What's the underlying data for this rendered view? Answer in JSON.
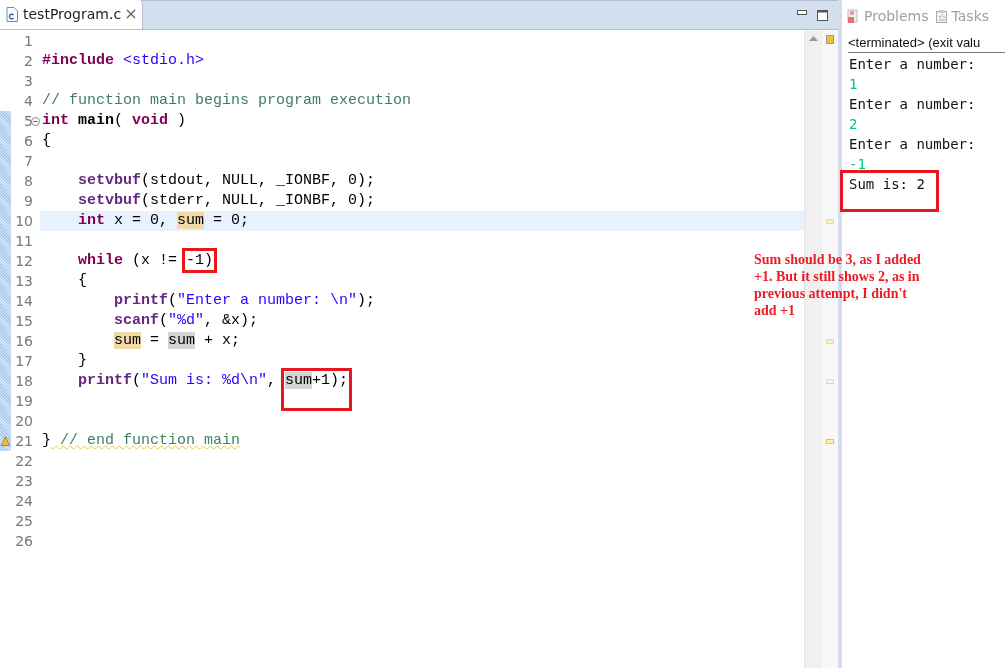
{
  "editor": {
    "tab": {
      "title": "testProgram.c",
      "selected": true
    },
    "lines": [
      {
        "number": "1",
        "changed": false
      },
      {
        "number": "2",
        "changed": false,
        "segments": [
          {
            "text": "#include",
            "kind": "keyword"
          },
          {
            "text": " <stdio.h>",
            "kind": "string"
          }
        ]
      },
      {
        "number": "3",
        "changed": false
      },
      {
        "number": "4",
        "changed": false,
        "segments": [
          {
            "text": "// function main begins program execution",
            "kind": "comment"
          }
        ]
      },
      {
        "number": "5",
        "changed": true,
        "folded": false,
        "segments": [
          {
            "text": "int",
            "kind": "keyword"
          },
          {
            "text": " main",
            "kind": "declaration"
          },
          {
            "text": "( ",
            "kind": "plain"
          },
          {
            "text": "void",
            "kind": "keyword"
          },
          {
            "text": " )",
            "kind": "plain"
          }
        ]
      },
      {
        "number": "6",
        "changed": true,
        "segments": [
          {
            "text": "{",
            "kind": "plain"
          }
        ]
      },
      {
        "number": "7",
        "changed": true
      },
      {
        "number": "8",
        "changed": true,
        "segments": [
          {
            "text": "    setvbuf",
            "kind": "function"
          },
          {
            "text": "(stdout, NULL, _IONBF, 0);",
            "kind": "plain"
          }
        ]
      },
      {
        "number": "9",
        "changed": true,
        "segments": [
          {
            "text": "    setvbuf",
            "kind": "function"
          },
          {
            "text": "(stderr, NULL, _IONBF, 0);",
            "kind": "plain"
          }
        ]
      },
      {
        "number": "10",
        "changed": true,
        "current": true,
        "segments": [
          {
            "text": "    int",
            "kind": "keyword"
          },
          {
            "text": " x = 0, ",
            "kind": "plain"
          },
          {
            "text": "sum",
            "kind": "plain",
            "occurrence_write": true
          },
          {
            "text": " = 0;",
            "kind": "plain"
          }
        ]
      },
      {
        "number": "11",
        "changed": true
      },
      {
        "number": "12",
        "changed": true,
        "segments": [
          {
            "text": "    while",
            "kind": "keyword"
          },
          {
            "text": " (x != ",
            "kind": "plain"
          },
          {
            "text": "-1)",
            "kind": "plain",
            "boxed": true
          }
        ]
      },
      {
        "number": "13",
        "changed": true,
        "segments": [
          {
            "text": "    {",
            "kind": "plain"
          }
        ]
      },
      {
        "number": "14",
        "changed": true,
        "segments": [
          {
            "text": "        printf",
            "kind": "function"
          },
          {
            "text": "(",
            "kind": "plain"
          },
          {
            "text": "\"Enter a number: \\n\"",
            "kind": "string"
          },
          {
            "text": ");",
            "kind": "plain"
          }
        ]
      },
      {
        "number": "15",
        "changed": true,
        "segments": [
          {
            "text": "        scanf",
            "kind": "function"
          },
          {
            "text": "(",
            "kind": "plain"
          },
          {
            "text": "\"%d\"",
            "kind": "string"
          },
          {
            "text": ", &x);",
            "kind": "plain"
          }
        ]
      },
      {
        "number": "16",
        "changed": true,
        "segments": [
          {
            "text": "        sum",
            "kind": "plain",
            "occurrence_write": true
          },
          {
            "text": " = ",
            "kind": "plain"
          },
          {
            "text": "sum",
            "kind": "plain",
            "occurrence_read": true
          },
          {
            "text": " + x;",
            "kind": "plain"
          }
        ]
      },
      {
        "number": "17",
        "changed": true,
        "segments": [
          {
            "text": "    }",
            "kind": "plain"
          }
        ]
      },
      {
        "number": "18",
        "changed": true,
        "segments": [
          {
            "text": "    printf",
            "kind": "function"
          },
          {
            "text": "(",
            "kind": "plain"
          },
          {
            "text": "\"Sum is: %d\\n\"",
            "kind": "string"
          },
          {
            "text": ", ",
            "kind": "plain"
          },
          {
            "text": "sum",
            "kind": "plain",
            "occurrence_read": true,
            "boxed": true,
            "box_tall": true
          },
          {
            "text": "+1);",
            "kind": "plain",
            "boxed": true
          }
        ]
      },
      {
        "number": "19",
        "changed": true
      },
      {
        "number": "20",
        "changed": true
      },
      {
        "number": "21",
        "changed": true,
        "warning": true,
        "segments": [
          {
            "text": "}",
            "kind": "plain"
          },
          {
            "text": " // end function main",
            "kind": "comment",
            "squiggle": true
          }
        ]
      },
      {
        "number": "22",
        "changed": false
      },
      {
        "number": "23",
        "changed": false
      },
      {
        "number": "24",
        "changed": false
      },
      {
        "number": "25",
        "changed": false
      },
      {
        "number": "26",
        "changed": false
      }
    ]
  },
  "note": "Sum should be 3, as I added +1. But it still shows 2, as in previous attempt, I didn't add +1",
  "console": {
    "tabs": [
      {
        "label": "Problems",
        "selected": false
      },
      {
        "label": "Tasks",
        "selected": false
      }
    ],
    "header": "<terminated> (exit valu",
    "lines": [
      {
        "text": "Enter a number:",
        "kind": "output"
      },
      {
        "text": "1",
        "kind": "input"
      },
      {
        "text": "Enter a number:",
        "kind": "output"
      },
      {
        "text": "2",
        "kind": "input"
      },
      {
        "text": "Enter a number:",
        "kind": "output"
      },
      {
        "text": "-1",
        "kind": "input"
      },
      {
        "text": "Sum is: 2",
        "kind": "output",
        "boxed": true
      }
    ]
  }
}
